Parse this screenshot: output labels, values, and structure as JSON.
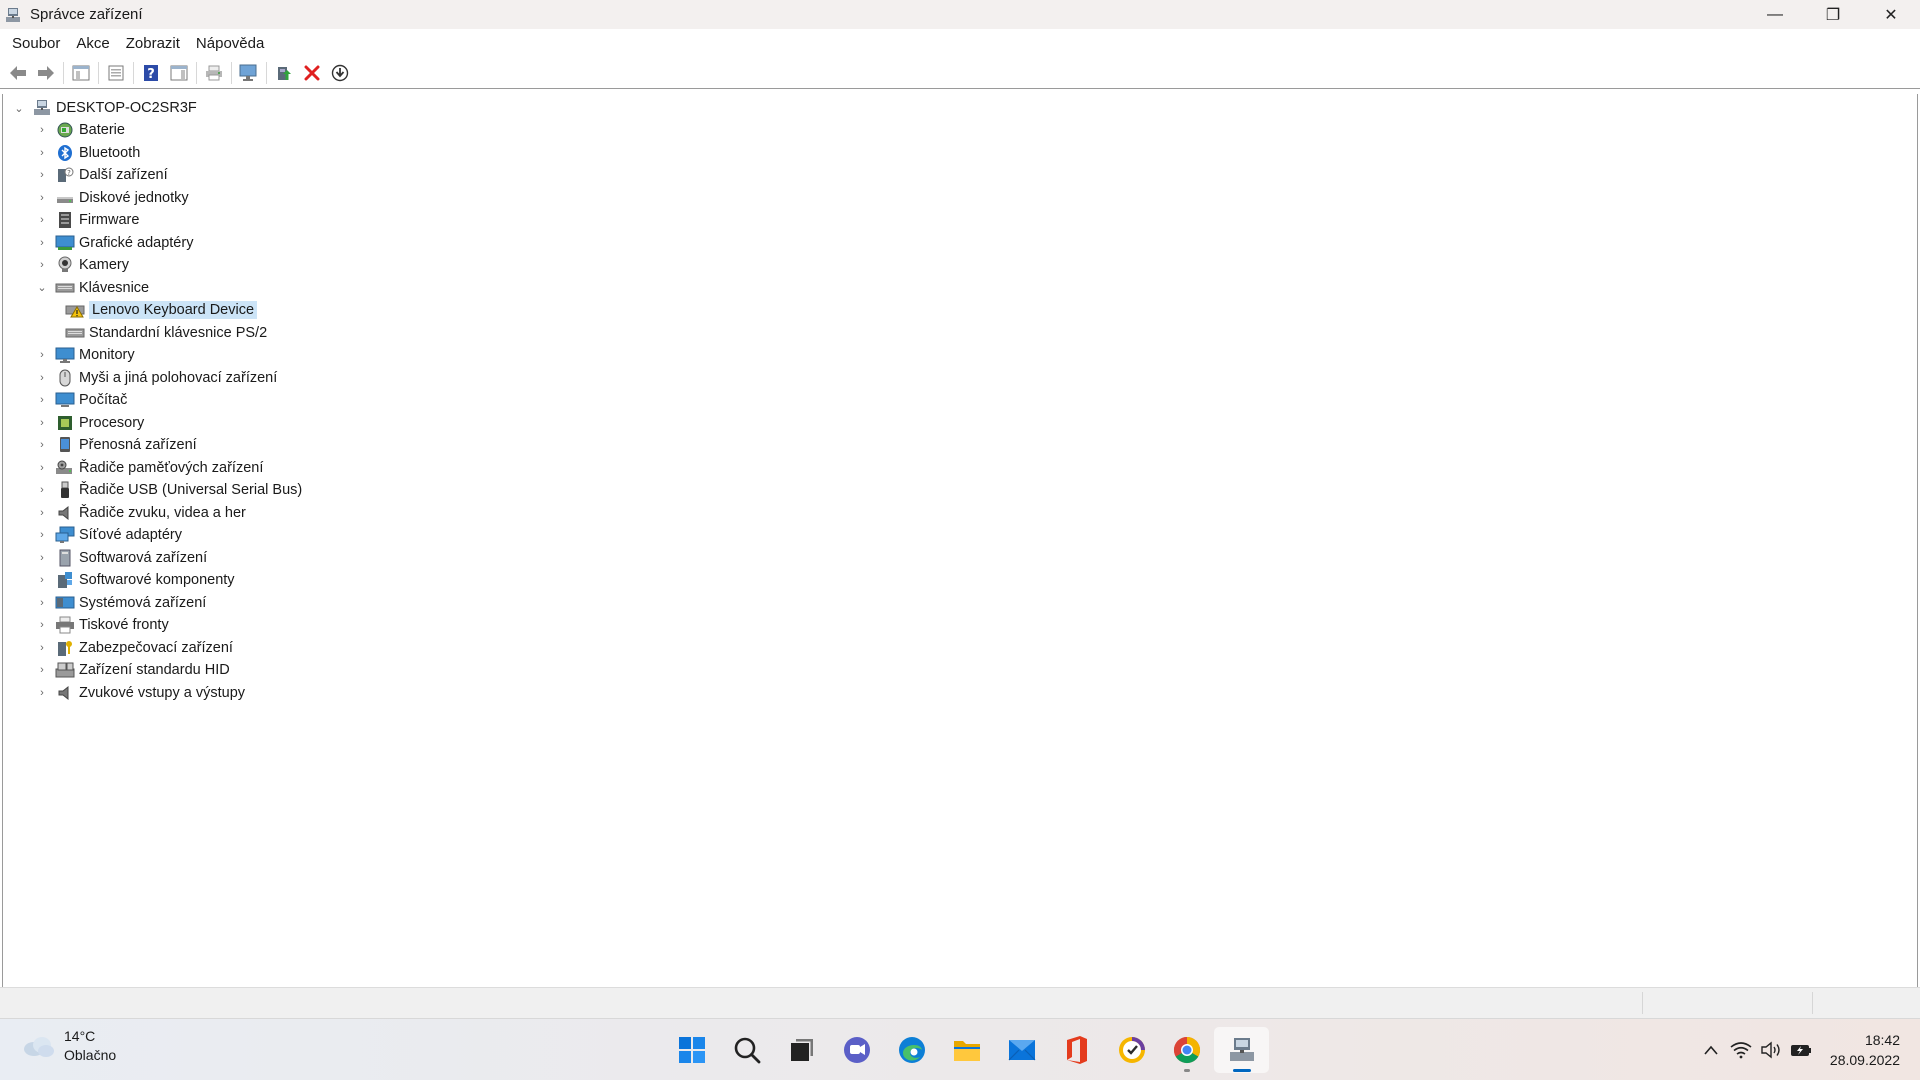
{
  "window": {
    "title": "Správce zařízení",
    "minimize_glyph": "—",
    "restore_glyph": "❐",
    "close_glyph": "✕"
  },
  "menu": [
    "Soubor",
    "Akce",
    "Zobrazit",
    "Nápověda"
  ],
  "toolbar": {
    "icons": [
      "back-arrow-icon",
      "forward-arrow-icon",
      "show-hide-console-tree-icon",
      "properties-icon",
      "help-icon",
      "action-pane-icon",
      "print-icon",
      "monitor-icon",
      "update-driver-icon",
      "uninstall-device-icon",
      "scan-hardware-icon"
    ]
  },
  "tree": {
    "root": "DESKTOP-OC2SR3F",
    "categories": [
      {
        "label": "Baterie",
        "icon": "battery-icon",
        "expanded": false
      },
      {
        "label": "Bluetooth",
        "icon": "bluetooth-icon",
        "expanded": false
      },
      {
        "label": "Další zařízení",
        "icon": "other-devices-icon",
        "expanded": false
      },
      {
        "label": "Diskové jednotky",
        "icon": "disk-drive-icon",
        "expanded": false
      },
      {
        "label": "Firmware",
        "icon": "firmware-icon",
        "expanded": false
      },
      {
        "label": "Grafické adaptéry",
        "icon": "display-adapter-icon",
        "expanded": false
      },
      {
        "label": "Kamery",
        "icon": "camera-icon",
        "expanded": false
      },
      {
        "label": "Klávesnice",
        "icon": "keyboard-icon",
        "expanded": true,
        "children": [
          {
            "label": "Lenovo Keyboard Device",
            "icon": "keyboard-warning-icon",
            "selected": true
          },
          {
            "label": "Standardní klávesnice PS/2",
            "icon": "keyboard-icon",
            "selected": false
          }
        ]
      },
      {
        "label": "Monitory",
        "icon": "monitor-icon",
        "expanded": false
      },
      {
        "label": "Myši a jiná polohovací zařízení",
        "icon": "mouse-icon",
        "expanded": false
      },
      {
        "label": "Počítač",
        "icon": "computer-icon",
        "expanded": false
      },
      {
        "label": "Procesory",
        "icon": "processor-icon",
        "expanded": false
      },
      {
        "label": "Přenosná zařízení",
        "icon": "portable-device-icon",
        "expanded": false
      },
      {
        "label": "Řadiče paměťových zařízení",
        "icon": "storage-controller-icon",
        "expanded": false
      },
      {
        "label": "Řadiče USB (Universal Serial Bus)",
        "icon": "usb-icon",
        "expanded": false
      },
      {
        "label": "Řadiče zvuku, videa a her",
        "icon": "sound-icon",
        "expanded": false
      },
      {
        "label": "Síťové adaptéry",
        "icon": "network-adapter-icon",
        "expanded": false
      },
      {
        "label": "Softwarová zařízení",
        "icon": "software-device-icon",
        "expanded": false
      },
      {
        "label": "Softwarové komponenty",
        "icon": "software-component-icon",
        "expanded": false
      },
      {
        "label": "Systémová zařízení",
        "icon": "system-device-icon",
        "expanded": false
      },
      {
        "label": "Tiskové fronty",
        "icon": "printer-icon",
        "expanded": false
      },
      {
        "label": "Zabezpečovací zařízení",
        "icon": "security-device-icon",
        "expanded": false
      },
      {
        "label": "Zařízení standardu HID",
        "icon": "hid-icon",
        "expanded": false
      },
      {
        "label": "Zvukové vstupy a výstupy",
        "icon": "audio-io-icon",
        "expanded": false
      }
    ]
  },
  "taskbar": {
    "weather": {
      "temp": "14°C",
      "condition": "Oblačno"
    },
    "apps": [
      "start-icon",
      "search-icon",
      "task-view-icon",
      "chat-icon",
      "edge-icon",
      "file-explorer-icon",
      "mail-icon",
      "office-icon",
      "norton-icon",
      "chrome-icon",
      "device-manager-icon"
    ],
    "clock": {
      "time": "18:42",
      "date": "28.09.2022"
    }
  },
  "colors": {
    "selection": "#cce4f7",
    "accent": "#0067c0",
    "uninstall_red": "#e02020"
  }
}
